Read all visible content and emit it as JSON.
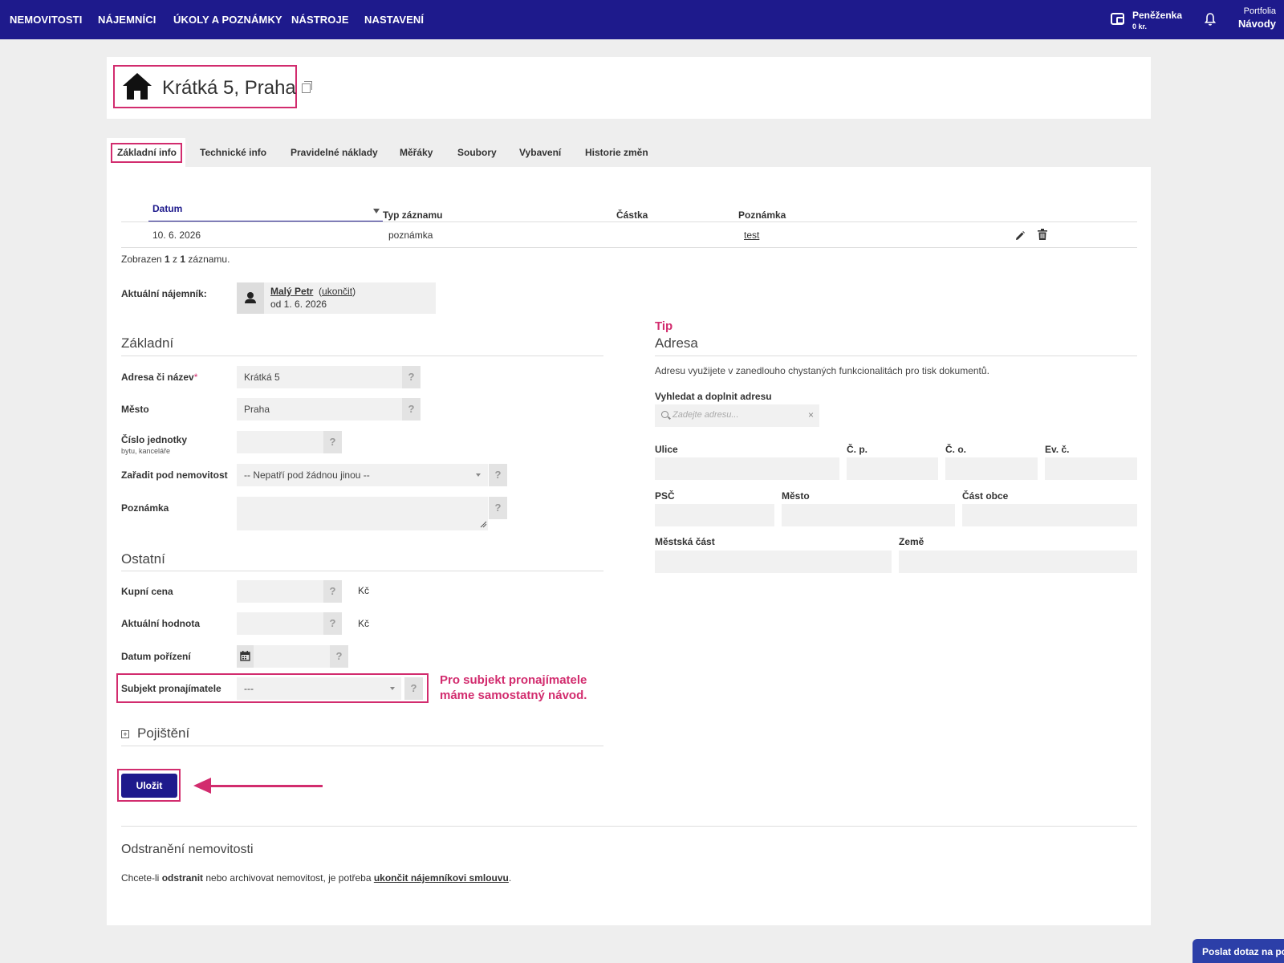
{
  "nav": {
    "items": [
      "NEMOVITOSTI",
      "NÁJEMNÍCI",
      "ÚKOLY A POZNÁMKY",
      "NÁSTROJE",
      "NASTAVENÍ"
    ],
    "wallet_label": "Peněženka",
    "wallet_value": "0 kr.",
    "portfolio_label": "Portfolia",
    "guides_label": "Návody"
  },
  "property": {
    "title": "Krátká 5, Praha"
  },
  "tabs": [
    "Základní info",
    "Technické info",
    "Pravidelné náklady",
    "Měřáky",
    "Soubory",
    "Vybavení",
    "Historie změn"
  ],
  "table": {
    "columns": [
      "Datum",
      "Typ záznamu",
      "Částka",
      "Poznámka"
    ],
    "rows": [
      {
        "date": "10. 6. 2026",
        "type": "poznámka",
        "amount": "",
        "note": "test"
      }
    ],
    "records_prefix": "Zobrazen ",
    "records_shown": "1",
    "records_mid": " z ",
    "records_total": "1",
    "records_suffix": " záznamu."
  },
  "tenant": {
    "label": "Aktuální nájemník:",
    "name": "Malý Petr",
    "end_link": "ukončit",
    "since": "od 1. 6. 2026"
  },
  "basic": {
    "section_title": "Základní",
    "address_label": "Adresa či název",
    "address_value": "Krátká 5",
    "city_label": "Město",
    "city_value": "Praha",
    "unit_label": "Číslo jednotky",
    "unit_sub": "bytu, kanceláře",
    "parent_label": "Zařadit pod nemovitost",
    "parent_value": "-- Nepatří pod žádnou jinou --",
    "note_label": "Poznámka",
    "help": "?"
  },
  "other": {
    "section_title": "Ostatní",
    "price_label": "Kupní cena",
    "value_label": "Aktuální hodnota",
    "currency": "Kč",
    "date_label": "Datum pořízení",
    "landlord_label": "Subjekt pronajímatele",
    "landlord_value": "---"
  },
  "insurance": {
    "title": "Pojištění",
    "toggle": "+"
  },
  "address": {
    "tip": "Tip",
    "section_title": "Adresa",
    "description": "Adresu využijete v zanedlouho chystaných funkcionalitách pro tisk dokumentů.",
    "search_label": "Vyhledat a doplnit adresu",
    "search_placeholder": "Zadejte adresu...",
    "clear": "×",
    "street": "Ulice",
    "cp": "Č. p.",
    "co": "Č. o.",
    "ev": "Ev. č.",
    "psc": "PSČ",
    "city": "Město",
    "district_part": "Část obce",
    "city_district": "Městská část",
    "country": "Země"
  },
  "annotation": {
    "line1": "Pro subjekt pronajímatele",
    "line2": "máme samostatný návod."
  },
  "save_label": "Uložit",
  "removal": {
    "title": "Odstranění nemovitosti",
    "text_pre": "Chcete-li ",
    "text_bold": "odstranit",
    "text_mid": " nebo archivovat nemovitost, je potřeba ",
    "text_link": "ukončit nájemníkovi smlouvu",
    "text_end": "."
  },
  "help_button": "Poslat dotaz na po",
  "colors": {
    "nav_bg": "#1e1a8c",
    "accent": "#d22c6e",
    "button": "#1e1a8c"
  }
}
